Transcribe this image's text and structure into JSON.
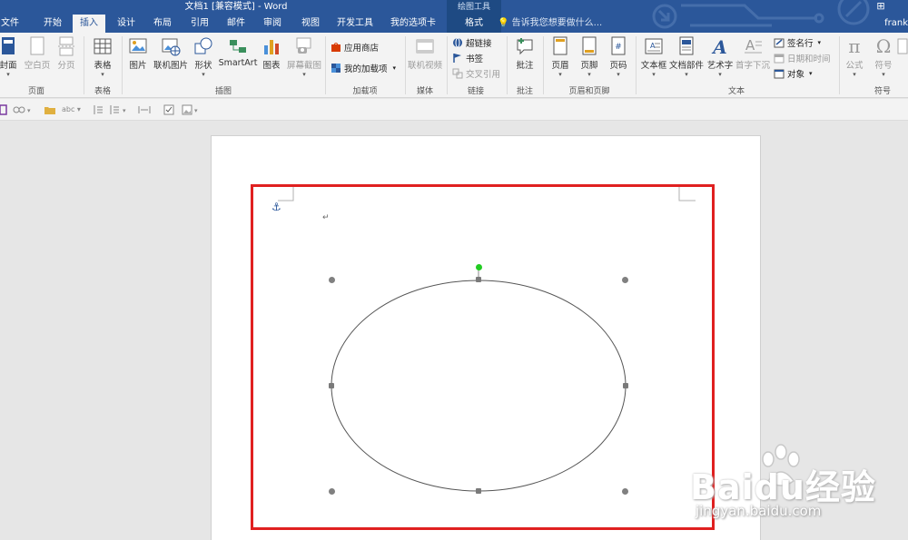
{
  "window": {
    "title": "文档1 [兼容模式] - Word",
    "context_tool_title": "绘图工具",
    "user": "frank"
  },
  "tabs": [
    "文件",
    "开始",
    "插入",
    "设计",
    "布局",
    "引用",
    "邮件",
    "审阅",
    "视图",
    "开发工具",
    "我的选项卡"
  ],
  "active_tab": "插入",
  "context_tab": "格式",
  "tell_me": "告诉我您想要做什么...",
  "ribbon": {
    "pages": {
      "cover": "封面",
      "blank": "空白页",
      "break": "分页",
      "group": "页面"
    },
    "tables": {
      "table": "表格",
      "group": "表格"
    },
    "illustrations": {
      "picture": "图片",
      "online_picture": "联机图片",
      "shapes": "形状",
      "smartart": "SmartArt",
      "chart": "图表",
      "screenshot": "屏幕截图",
      "group": "插图"
    },
    "addins": {
      "store": "应用商店",
      "my_addins": "我的加载项",
      "group": "加载项"
    },
    "media": {
      "online_video": "联机视频",
      "group": "媒体"
    },
    "links": {
      "hyperlink": "超链接",
      "bookmark": "书签",
      "cross_ref": "交叉引用",
      "group": "链接"
    },
    "comments": {
      "comment": "批注",
      "group": "批注"
    },
    "header_footer": {
      "header": "页眉",
      "footer": "页脚",
      "page_number": "页码",
      "group": "页眉和页脚"
    },
    "text": {
      "textbox": "文本框",
      "quick_parts": "文档部件",
      "wordart": "艺术字",
      "dropcap": "首字下沉",
      "signature": "签名行",
      "datetime": "日期和时间",
      "object": "对象",
      "group": "文本"
    },
    "symbols": {
      "equation": "公式",
      "symbol": "符号",
      "group": "符号"
    }
  },
  "quick_toolbar": {
    "font_hint": "abc"
  },
  "document": {
    "paragraph_mark": "↵",
    "anchor_glyph": "⚓"
  },
  "watermark": {
    "brand": "Baidu经验",
    "url": "jingyan.baidu.com"
  },
  "colors": {
    "brand": "#2b579a",
    "context": "#1e4a83",
    "highlight": "#e02020",
    "rotate_handle": "#22cc22"
  }
}
